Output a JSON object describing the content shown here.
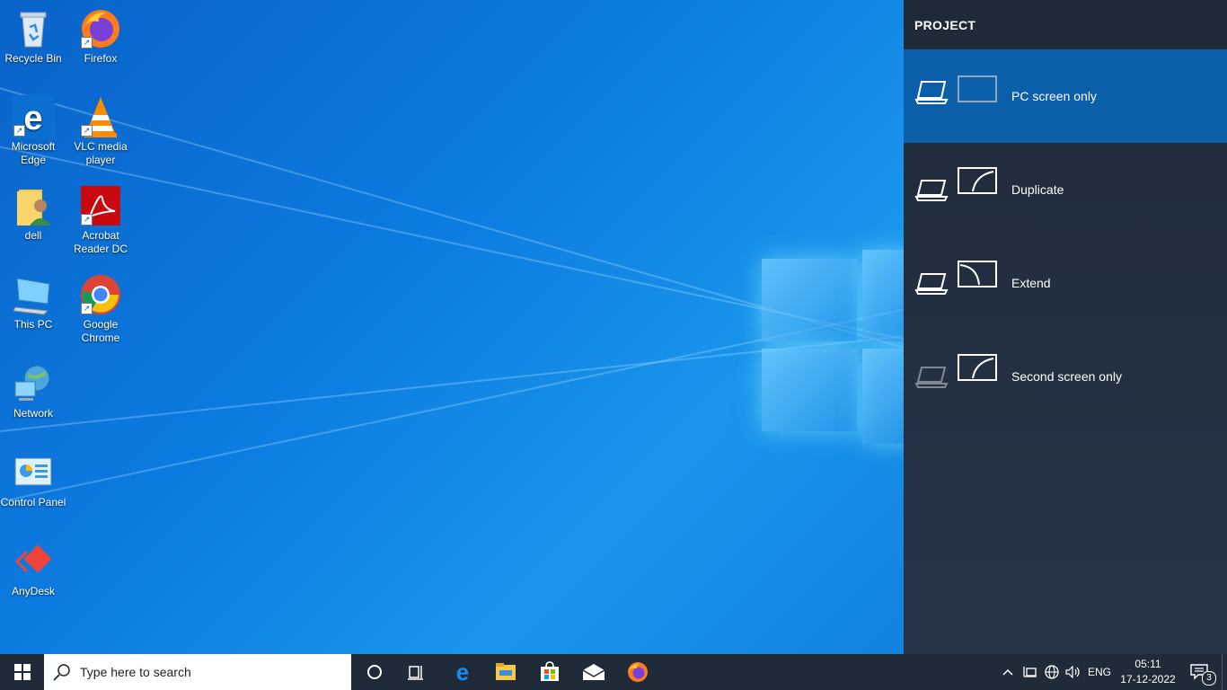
{
  "desktop": {
    "icons": [
      {
        "label": "Recycle Bin",
        "icon": "recycle-bin-icon"
      },
      {
        "label": "Firefox",
        "icon": "firefox-icon"
      },
      {
        "label": "Microsoft Edge",
        "icon": "edge-icon"
      },
      {
        "label": "VLC media player",
        "icon": "vlc-icon"
      },
      {
        "label": "dell",
        "icon": "user-folder-icon"
      },
      {
        "label": "Acrobat Reader DC",
        "icon": "acrobat-icon"
      },
      {
        "label": "This PC",
        "icon": "this-pc-icon"
      },
      {
        "label": "Google Chrome",
        "icon": "chrome-icon"
      },
      {
        "label": "Network",
        "icon": "network-icon"
      },
      {
        "label": "Control Panel",
        "icon": "control-panel-icon"
      },
      {
        "label": "AnyDesk",
        "icon": "anydesk-icon"
      }
    ]
  },
  "project_panel": {
    "title": "PROJECT",
    "options": [
      {
        "label": "PC screen only",
        "selected": true
      },
      {
        "label": "Duplicate",
        "selected": false
      },
      {
        "label": "Extend",
        "selected": false
      },
      {
        "label": "Second screen only",
        "selected": false
      }
    ],
    "selected_color": "#0b5ea8"
  },
  "taskbar": {
    "search_placeholder": "Type here to search",
    "pinned": [
      "cortana-icon",
      "task-view-icon",
      "edge-icon",
      "file-explorer-icon",
      "store-icon",
      "mail-icon",
      "firefox-icon"
    ],
    "tray": {
      "language": "ENG",
      "time": "05:11",
      "date": "17-12-2022",
      "notifications": "3"
    }
  }
}
